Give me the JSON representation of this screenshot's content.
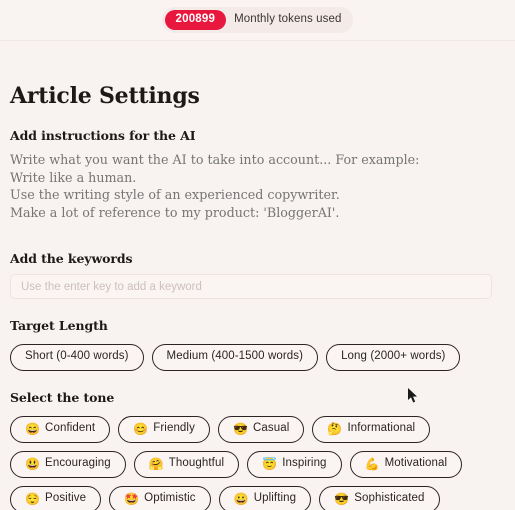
{
  "topbar": {
    "token_count": "200899",
    "token_label": "Monthly tokens used",
    "badge_color": "#e8173d",
    "pill_background": "#f4eae8"
  },
  "page": {
    "title": "Article Settings",
    "background": "#f8f2f0"
  },
  "instructions": {
    "label": "Add instructions for the AI",
    "placeholder": "Write what you want the AI to take into account... For example:\nWrite like a human.\nUse the writing style of an experienced copywriter.\nMake a lot of reference to my product: 'BloggerAI'.",
    "value": ""
  },
  "keywords": {
    "label": "Add the keywords",
    "placeholder": "Use the enter key to add a keyword",
    "value": ""
  },
  "target_length": {
    "label": "Target Length",
    "options": [
      {
        "label": "Short (0-400 words)"
      },
      {
        "label": "Medium (400-1500 words)"
      },
      {
        "label": "Long (2000+ words)"
      }
    ]
  },
  "tone": {
    "label": "Select the tone",
    "rows": [
      [
        {
          "emoji": "😄",
          "icon": "grinning-face-icon",
          "label": "Confident"
        },
        {
          "emoji": "😊",
          "icon": "smiling-face-icon",
          "label": "Friendly"
        },
        {
          "emoji": "😎",
          "icon": "sunglasses-face-icon",
          "label": "Casual"
        },
        {
          "emoji": "🤔",
          "icon": "thinking-face-icon",
          "label": "Informational"
        }
      ],
      [
        {
          "emoji": "😃",
          "icon": "grinning-face-big-eyes-icon",
          "label": "Encouraging"
        },
        {
          "emoji": "🤗",
          "icon": "hugging-face-icon",
          "label": "Thoughtful"
        },
        {
          "emoji": "😇",
          "icon": "halo-face-icon",
          "label": "Inspiring"
        },
        {
          "emoji": "💪",
          "icon": "flexed-biceps-icon",
          "label": "Motivational"
        }
      ],
      [
        {
          "emoji": "😌",
          "icon": "relieved-face-icon",
          "label": "Positive"
        },
        {
          "emoji": "🤩",
          "icon": "star-struck-face-icon",
          "label": "Optimistic"
        },
        {
          "emoji": "😀",
          "icon": "grinning-face-open-icon",
          "label": "Uplifting"
        },
        {
          "emoji": "😎",
          "icon": "cool-face-icon",
          "label": "Sophisticated"
        }
      ]
    ]
  }
}
